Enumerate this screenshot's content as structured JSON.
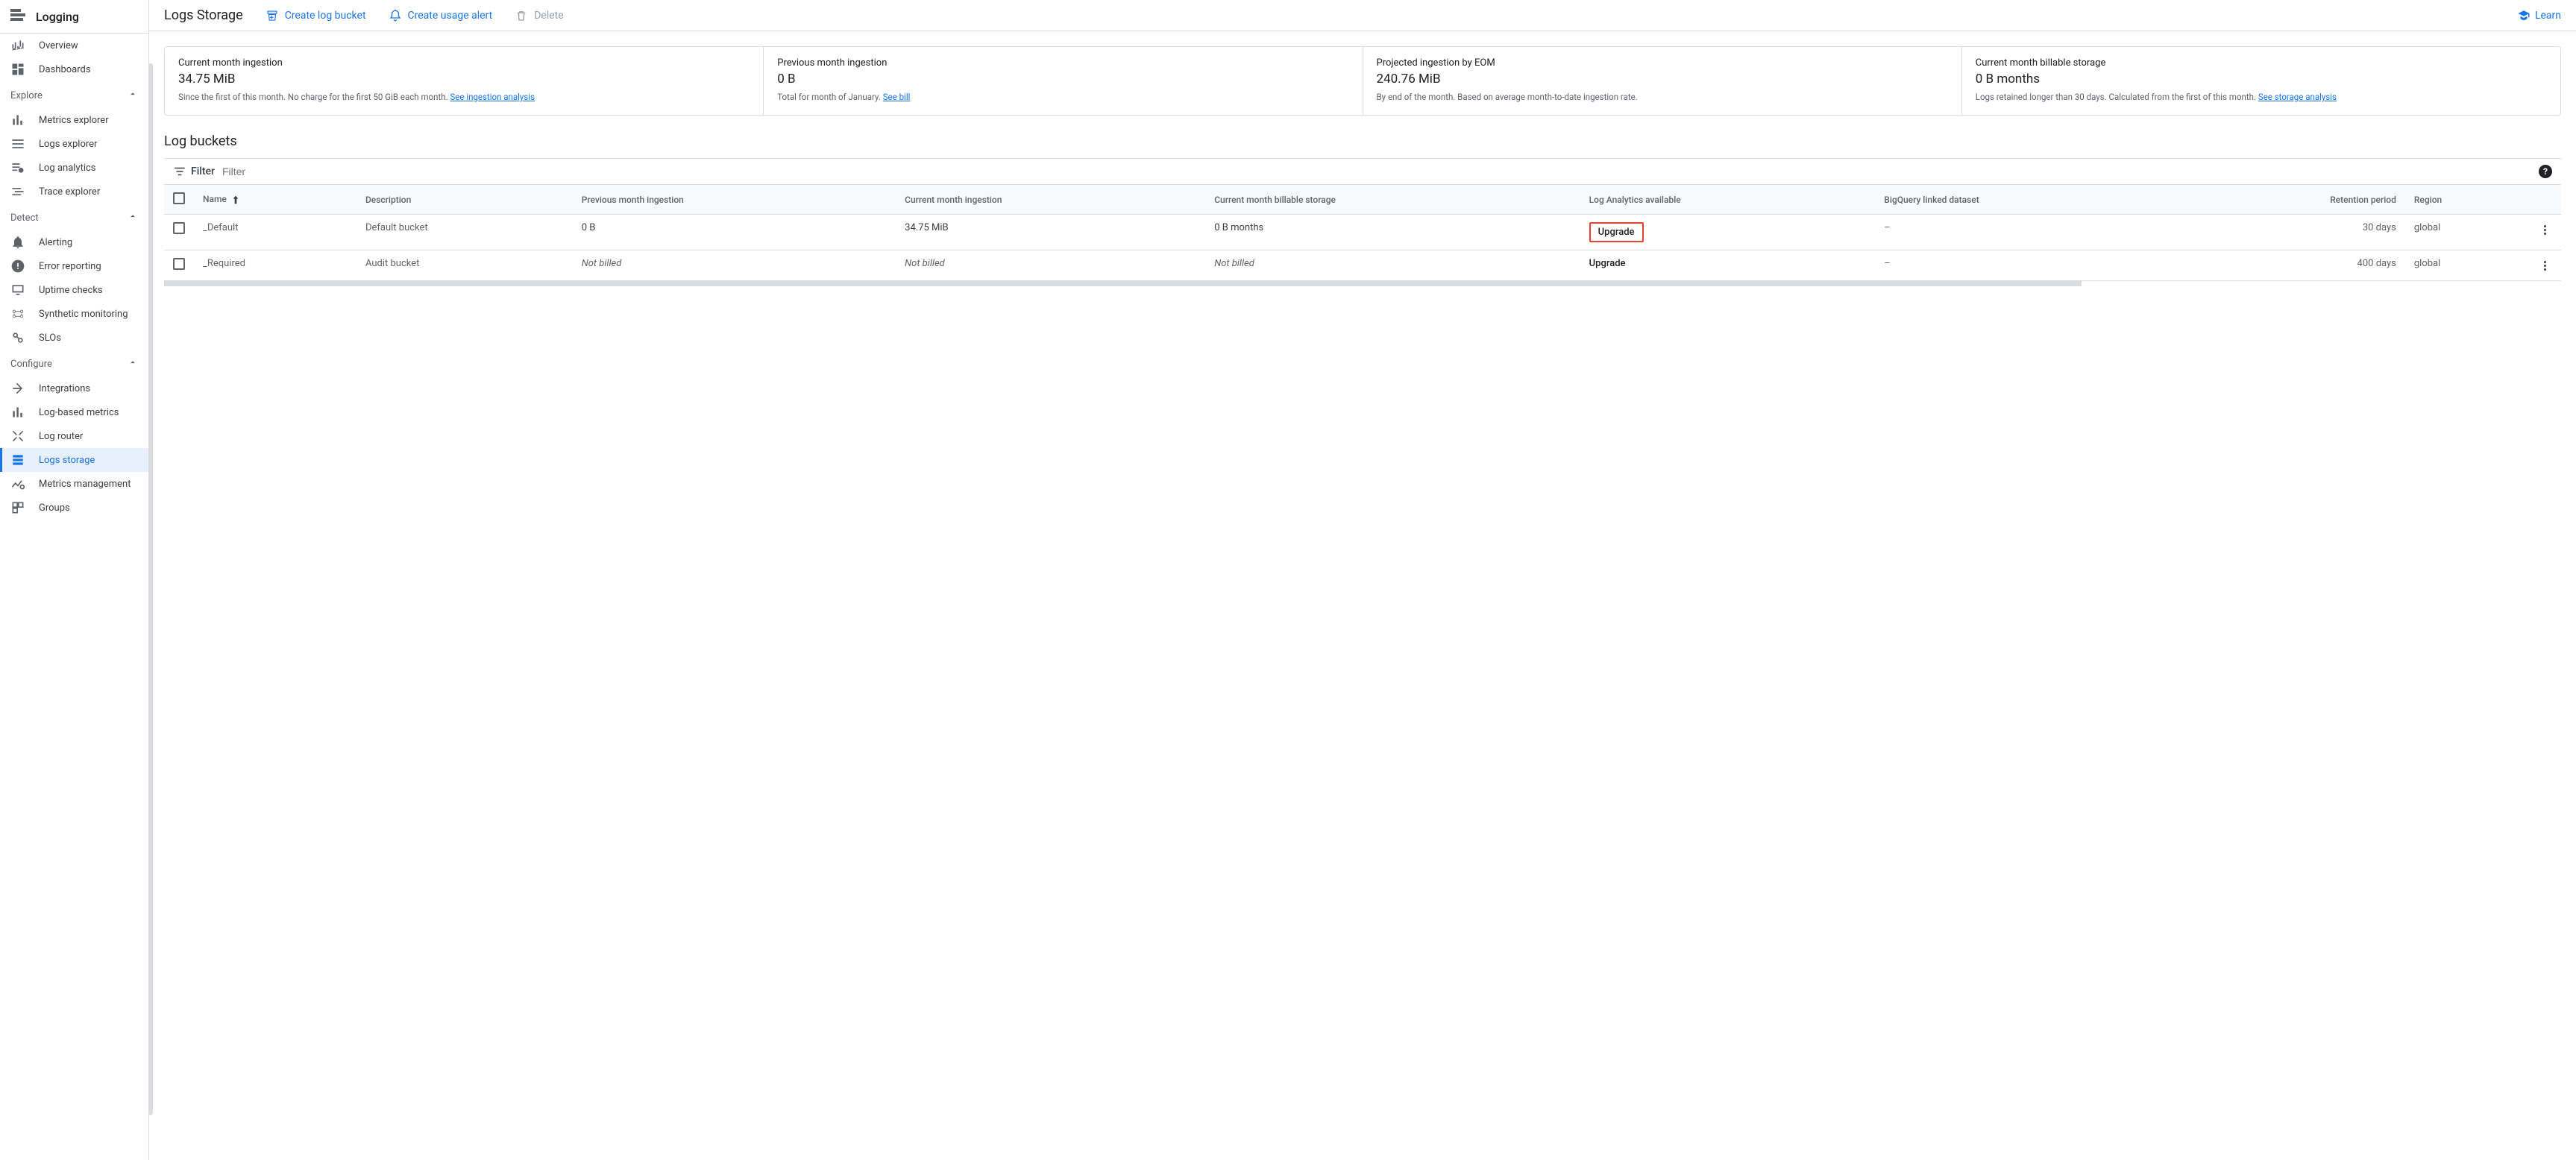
{
  "header": {
    "product": "Logging"
  },
  "sidebar": {
    "top": [
      {
        "label": "Overview"
      },
      {
        "label": "Dashboards"
      }
    ],
    "sections": [
      {
        "title": "Explore",
        "items": [
          {
            "label": "Metrics explorer"
          },
          {
            "label": "Logs explorer"
          },
          {
            "label": "Log analytics"
          },
          {
            "label": "Trace explorer"
          }
        ]
      },
      {
        "title": "Detect",
        "items": [
          {
            "label": "Alerting"
          },
          {
            "label": "Error reporting"
          },
          {
            "label": "Uptime checks"
          },
          {
            "label": "Synthetic monitoring"
          },
          {
            "label": "SLOs"
          }
        ]
      },
      {
        "title": "Configure",
        "items": [
          {
            "label": "Integrations"
          },
          {
            "label": "Log-based metrics"
          },
          {
            "label": "Log router"
          },
          {
            "label": "Logs storage"
          },
          {
            "label": "Metrics management"
          },
          {
            "label": "Groups"
          }
        ]
      }
    ]
  },
  "topbar": {
    "title": "Logs Storage",
    "create_bucket": "Create log bucket",
    "create_alert": "Create usage alert",
    "delete": "Delete",
    "learn": "Learn"
  },
  "stats": [
    {
      "title": "Current month ingestion",
      "value": "34.75 MiB",
      "desc_pre": "Since the first of this month. No charge for the first 50 GiB each month. ",
      "link": "See ingestion analysis"
    },
    {
      "title": "Previous month ingestion",
      "value": "0 B",
      "desc_pre": "Total for month of January. ",
      "link": "See bill"
    },
    {
      "title": "Projected ingestion by EOM",
      "value": "240.76 MiB",
      "desc_pre": "By end of the month. Based on average month-to-date ingestion rate.",
      "link": ""
    },
    {
      "title": "Current month billable storage",
      "value": "0 B months",
      "desc_pre": "Logs retained longer than 30 days. Calculated from the first of this month. ",
      "link": "See storage analysis"
    }
  ],
  "table": {
    "section_title": "Log buckets",
    "filter_label": "Filter",
    "filter_placeholder": "Filter",
    "columns": {
      "name": "Name",
      "description": "Description",
      "prev_ingestion": "Previous month ingestion",
      "curr_ingestion": "Current month ingestion",
      "curr_storage": "Current month billable storage",
      "analytics": "Log Analytics available",
      "bigquery": "BigQuery linked dataset",
      "retention": "Retention period",
      "region": "Region"
    },
    "rows": [
      {
        "name": "_Default",
        "description": "Default bucket",
        "prev_ingestion": "0 B",
        "curr_ingestion": "34.75 MiB",
        "curr_storage": "0 B months",
        "analytics": "Upgrade",
        "bigquery": "–",
        "retention": "30 days",
        "region": "global",
        "highlighted": true
      },
      {
        "name": "_Required",
        "description": "Audit bucket",
        "prev_ingestion": "Not billed",
        "curr_ingestion": "Not billed",
        "curr_storage": "Not billed",
        "analytics": "Upgrade",
        "bigquery": "–",
        "retention": "400 days",
        "region": "global",
        "highlighted": false,
        "italic": true
      }
    ]
  }
}
